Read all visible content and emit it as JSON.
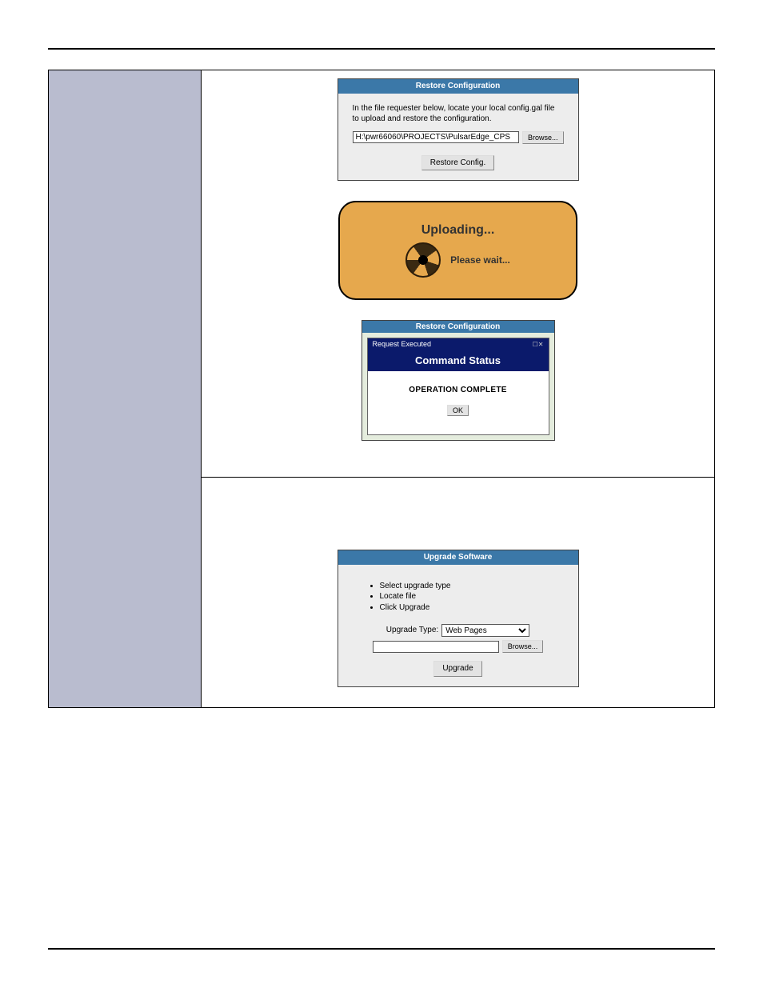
{
  "restore_panel": {
    "title": "Restore Configuration",
    "instruction": "In the file requester below, locate your local config.gal file to upload and restore the configuration.",
    "file_value": "H:\\pwr66060\\PROJECTS\\PulsarEdge_CPS",
    "browse_label": "Browse...",
    "restore_label": "Restore Config."
  },
  "uploading": {
    "title": "Uploading...",
    "wait": "Please wait..."
  },
  "command_status": {
    "panel_title": "Restore Configuration",
    "req_label": "Request Executed",
    "title": "Command Status",
    "message": "OPERATION COMPLETE",
    "ok_label": "OK"
  },
  "upgrade_panel": {
    "title": "Upgrade Software",
    "step1": "Select upgrade type",
    "step2": "Locate file",
    "step3": "Click Upgrade",
    "type_label": "Upgrade Type:",
    "type_value": "Web Pages",
    "file_value": "",
    "browse_label": "Browse...",
    "upgrade_label": "Upgrade"
  }
}
